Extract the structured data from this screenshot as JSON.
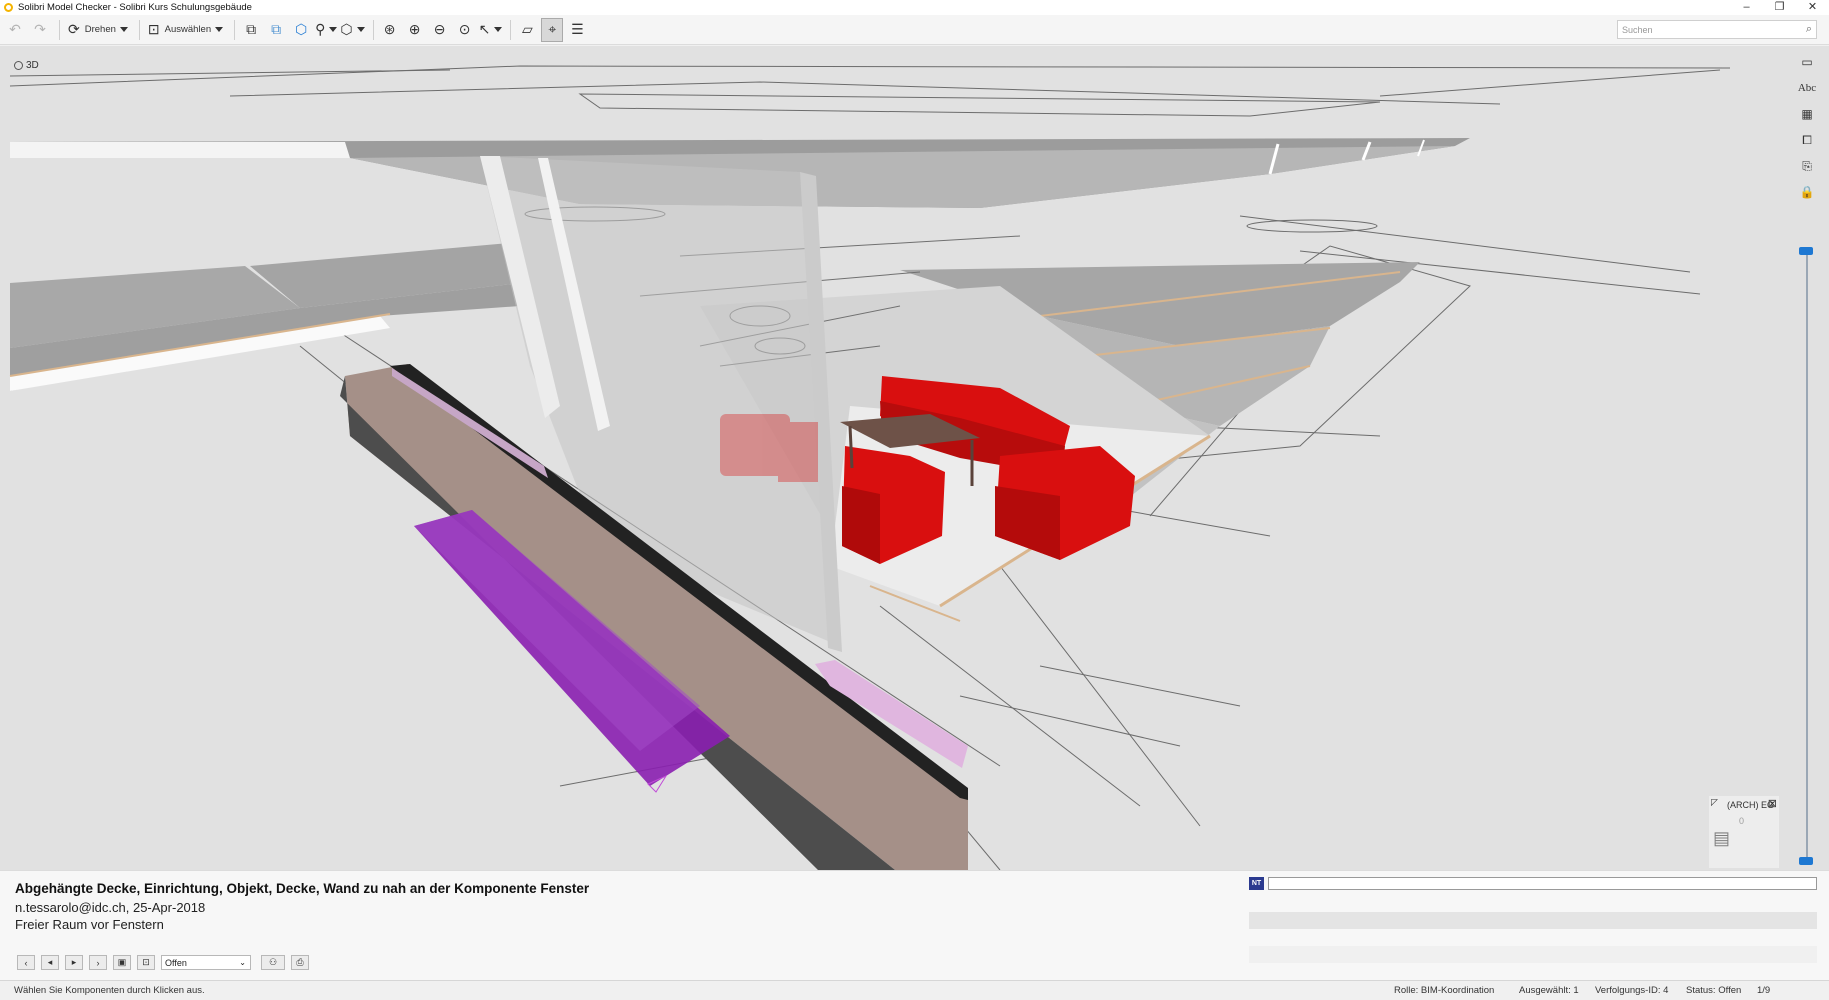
{
  "window": {
    "title": "Solibri Model Checker - Solibri Kurs Schulungsgebäude",
    "controls": [
      "–",
      "❐",
      "✕"
    ]
  },
  "toolbar": {
    "rotate_label": "Drehen",
    "select_label": "Auswählen",
    "search_placeholder": "Suchen"
  },
  "viewport": {
    "view_label": "3D",
    "floor_label": "(ARCH) EG",
    "floor_value": "0",
    "right_tool_text": "Abc"
  },
  "issue": {
    "title": "Abgehängte Decke, Einrichtung, Objekt, Decke, Wand zu nah an der Komponente Fenster",
    "author_date": "n.tessarolo@idc.ch, 25-Apr-2018",
    "description": "Freier Raum vor Fenstern",
    "status_value": "Offen",
    "comment_badge": "NT"
  },
  "statusbar": {
    "hint": "Wählen Sie Komponenten durch Klicken aus.",
    "role": "Rolle: BIM-Koordination",
    "selected": "Ausgewählt: 1",
    "tracking_id": "Verfolgungs-ID: 4",
    "status": "Status: Offen",
    "pager": "1/9"
  },
  "colors": {
    "furniture_red": "#d90f0f",
    "issue_purple": "#8a1fb0",
    "selection_pink": "#e0b6df",
    "slider_blue": "#1e78d2",
    "table_brown": "#6e5248"
  }
}
